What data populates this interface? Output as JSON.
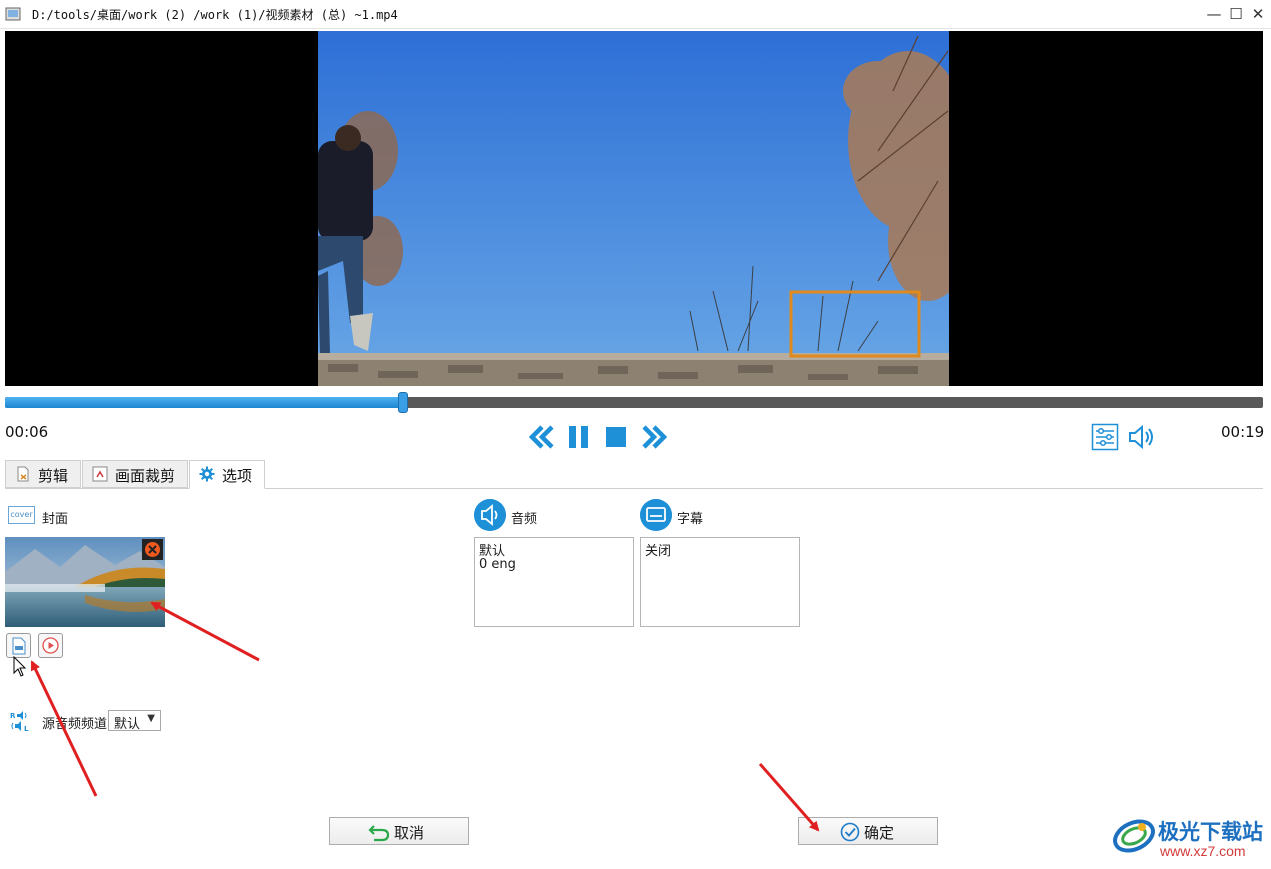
{
  "window": {
    "title": "D:/tools/桌面/work (2) /work (1)/视频素材 (总) ~1.mp4",
    "minimize_icon": "minimize-icon",
    "maximize_icon": "maximize-icon",
    "close_icon": "close-icon"
  },
  "player": {
    "current_time": "00:06",
    "total_time": "00:19",
    "progress": 0.316,
    "controls": [
      "rewind-icon",
      "pause-icon",
      "stop-icon",
      "fast-forward-icon",
      "settings-sliders-icon",
      "volume-icon"
    ]
  },
  "tabs": [
    {
      "label": "剪辑",
      "icon": "clip-icon",
      "active": false
    },
    {
      "label": "画面裁剪",
      "icon": "crop-icon",
      "active": false
    },
    {
      "label": "选项",
      "icon": "gear-icon",
      "active": true
    }
  ],
  "options": {
    "cover": {
      "icon_text": "cover",
      "label": "封面"
    },
    "source_audio": {
      "label": "源音频频道",
      "value": "默认"
    },
    "audio": {
      "label": "音频",
      "items": [
        "默认",
        "0 eng"
      ]
    },
    "subtitle": {
      "label": "字幕",
      "items": [
        "关闭"
      ]
    }
  },
  "buttons": {
    "cancel": "取消",
    "ok": "确定"
  },
  "watermark": {
    "name": "极光下载站",
    "url": "www.xz7.com"
  },
  "colors": {
    "accent": "#1e90d8",
    "progress": "#2f97e0",
    "annotation_arrow": "#e02020",
    "highlight_box": "#e08a1e"
  }
}
